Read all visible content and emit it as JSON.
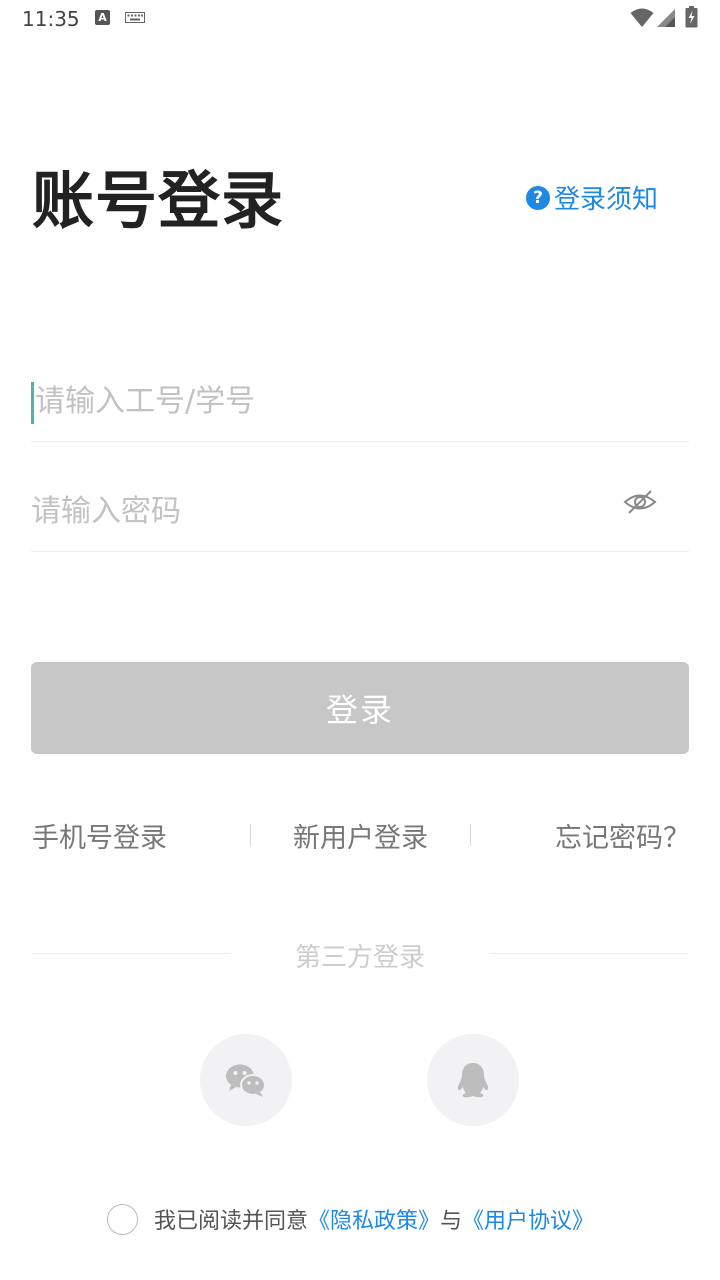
{
  "status_bar": {
    "time": "11:35",
    "a_icon_letter": "A",
    "icons": [
      "a-notification-icon",
      "keyboard-icon",
      "wifi-icon",
      "signal-icon",
      "battery-charging-icon"
    ]
  },
  "header": {
    "title": "账号登录",
    "notice_label": "登录须知",
    "notice_icon": "question-circle-icon"
  },
  "form": {
    "account_placeholder": "请输入工号/学号",
    "account_value": "",
    "password_placeholder": "请输入密码",
    "password_value": "",
    "password_toggle_icon": "eye-off-icon"
  },
  "login_button": {
    "label": "登录"
  },
  "links": {
    "phone_login": "手机号登录",
    "new_user_login": "新用户登录",
    "forgot_password": "忘记密码？"
  },
  "third_party": {
    "label": "第三方登录",
    "providers": [
      "wechat-icon",
      "qq-icon"
    ]
  },
  "agreement": {
    "prefix": "我已阅读并同意",
    "privacy_policy": "《隐私政策》",
    "conjunction": "与",
    "user_agreement": "《用户协议》",
    "checked": false
  },
  "colors": {
    "accent": "#1e88e5",
    "caret": "#4db6ac",
    "button_disabled": "#c7c7c7",
    "title": "#222222",
    "placeholder": "#c2c2c2"
  }
}
